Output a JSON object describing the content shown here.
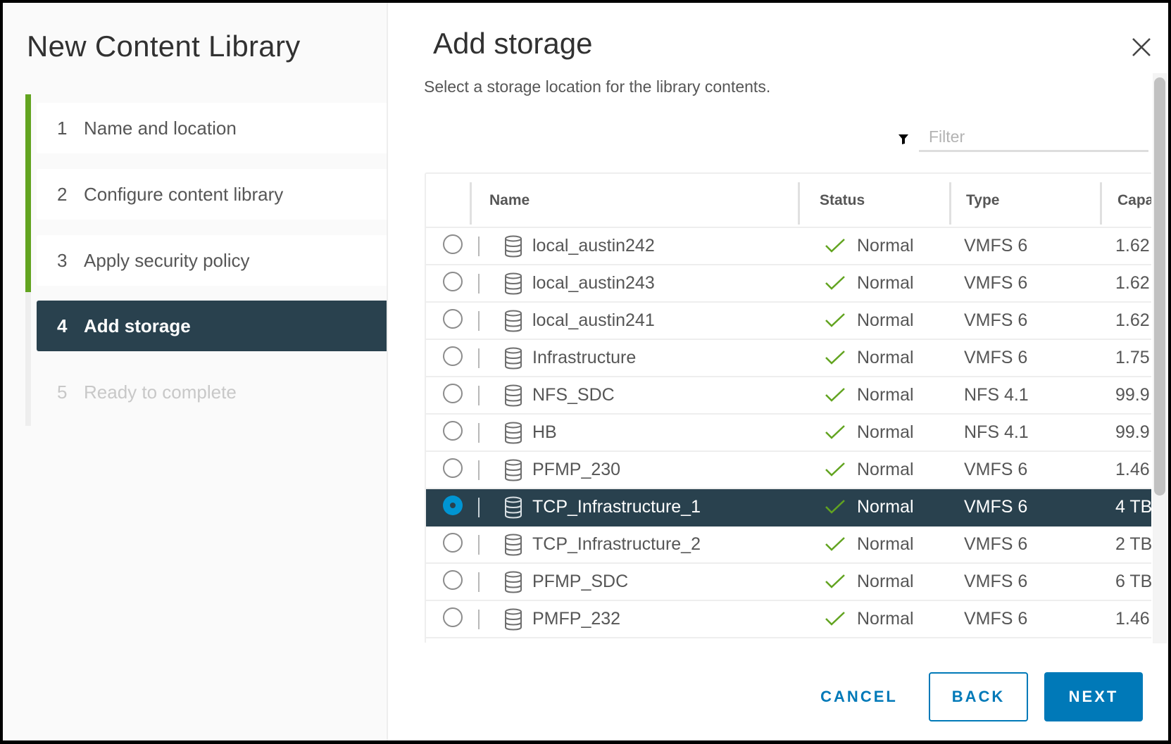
{
  "wizard": {
    "title": "New Content Library",
    "steps": [
      {
        "number": "1",
        "label": "Name and location",
        "state": "completed"
      },
      {
        "number": "2",
        "label": "Configure content library",
        "state": "completed"
      },
      {
        "number": "3",
        "label": "Apply security policy",
        "state": "completed"
      },
      {
        "number": "4",
        "label": "Add storage",
        "state": "active"
      },
      {
        "number": "5",
        "label": "Ready to complete",
        "state": "disabled"
      }
    ],
    "colors": {
      "progress_complete": "#62a420",
      "active_step_bg": "#29414e",
      "primary": "#0079b8",
      "status_ok": "#62a420"
    }
  },
  "page": {
    "heading": "Add storage",
    "subtitle": "Select a storage location for the library contents.",
    "close_icon": "close-icon"
  },
  "filter": {
    "icon": "filter-icon",
    "placeholder": "Filter",
    "value": ""
  },
  "grid": {
    "columns": [
      "Name",
      "Status",
      "Type",
      "Capa"
    ],
    "rows": [
      {
        "name": "local_austin242",
        "status": "Normal",
        "type": "VMFS 6",
        "capacity": "1.62",
        "selected": false
      },
      {
        "name": "local_austin243",
        "status": "Normal",
        "type": "VMFS 6",
        "capacity": "1.62",
        "selected": false
      },
      {
        "name": "local_austin241",
        "status": "Normal",
        "type": "VMFS 6",
        "capacity": "1.62",
        "selected": false
      },
      {
        "name": "Infrastructure",
        "status": "Normal",
        "type": "VMFS 6",
        "capacity": "1.75",
        "selected": false
      },
      {
        "name": "NFS_SDC",
        "status": "Normal",
        "type": "NFS 4.1",
        "capacity": "99.9",
        "selected": false
      },
      {
        "name": "HB",
        "status": "Normal",
        "type": "NFS 4.1",
        "capacity": "99.9",
        "selected": false
      },
      {
        "name": "PFMP_230",
        "status": "Normal",
        "type": "VMFS 6",
        "capacity": "1.46",
        "selected": false
      },
      {
        "name": "TCP_Infrastructure_1",
        "status": "Normal",
        "type": "VMFS 6",
        "capacity": "4 TB",
        "selected": true
      },
      {
        "name": "TCP_Infrastructure_2",
        "status": "Normal",
        "type": "VMFS 6",
        "capacity": "2 TB",
        "selected": false
      },
      {
        "name": "PFMP_SDC",
        "status": "Normal",
        "type": "VMFS 6",
        "capacity": "6 TB",
        "selected": false
      },
      {
        "name": "PMFP_232",
        "status": "Normal",
        "type": "VMFS 6",
        "capacity": "1.46",
        "selected": false
      }
    ]
  },
  "footer": {
    "cancel_label": "CANCEL",
    "back_label": "BACK",
    "next_label": "NEXT"
  }
}
